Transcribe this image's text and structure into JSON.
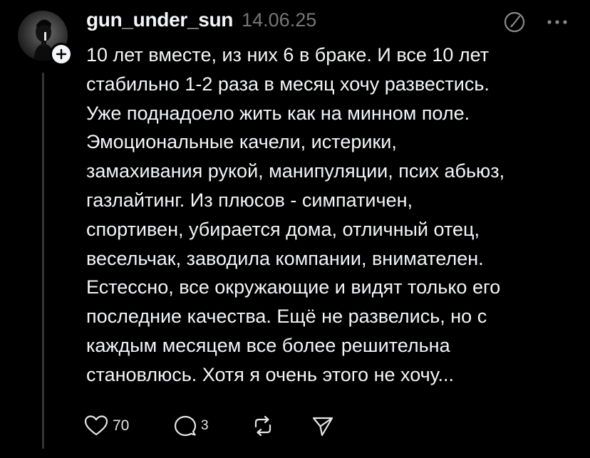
{
  "post": {
    "username": "gun_under_sun",
    "date": "14.06.25",
    "text_lines": [
      "10 лет вместе, из них 6 в браке. И все 10 лет",
      "стабильно 1-2 раза в месяц хочу развестись.",
      "Уже поднадоело жить как на минном поле.",
      "Эмоциональные качели, истерики,",
      "замахивания рукой, манипуляции, псих абьюз,",
      "газлайтинг. Из плюсов - симпатичен,",
      "спортивен, убирается дома, отличный отец,",
      "весельчак, заводила компании, внимателен.",
      "Естессно, все окружающие и видят только его",
      "последние качества. Ещё не развелись, но с",
      "каждым месяцем все более решительна",
      "становлюсь. Хотя я очень этого не хочу..."
    ],
    "likes": "70",
    "replies": "3"
  },
  "icons": {
    "like": "heart-icon",
    "reply": "comment-icon",
    "repost": "repost-icon",
    "share": "share-icon",
    "edit": "edit-icon",
    "more": "more-icon",
    "follow": "plus-icon"
  },
  "colors": {
    "background": "#000000",
    "text": "#f3f5f7",
    "muted": "#777777",
    "thread_line": "#333638"
  }
}
